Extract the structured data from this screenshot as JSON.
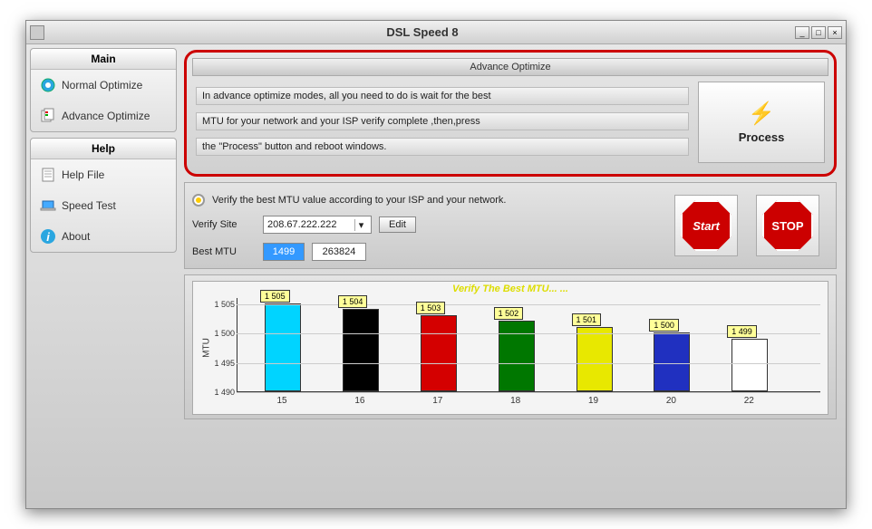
{
  "titlebar": {
    "title": "DSL Speed 8"
  },
  "sidebar": {
    "main_header": "Main",
    "help_header": "Help",
    "items": {
      "normal": "Normal Optimize",
      "advance": "Advance Optimize",
      "helpfile": "Help File",
      "speedtest": "Speed Test",
      "about": "About"
    }
  },
  "advance": {
    "header": "Advance Optimize",
    "line1": "In advance optimize modes, all you need to do is wait for the best",
    "line2": "MTU for your network and your ISP verify complete ,then,press",
    "line3": "the \"Process\" button and reboot windows.",
    "process_label": "Process"
  },
  "verify": {
    "radio_label": "Verify the best MTU value according to your ISP and your network.",
    "site_label": "Verify Site",
    "site_value": "208.67.222.222",
    "edit_label": "Edit",
    "bestmtu_label": "Best MTU",
    "bestmtu_value": "1499",
    "bestmtu_bytes": "263824",
    "start_label": "Start",
    "stop_label": "STOP"
  },
  "chart_title": "Verify The Best MTU... ...",
  "chart_data": {
    "type": "bar",
    "title": "Verify The Best MTU... ...",
    "ylabel": "MTU",
    "xlabel": "",
    "categories": [
      "15",
      "16",
      "17",
      "18",
      "19",
      "20",
      "22"
    ],
    "values": [
      1505,
      1504,
      1503,
      1502,
      1501,
      1500,
      1499
    ],
    "colors": [
      "#00d4ff",
      "#000000",
      "#d40000",
      "#007700",
      "#e8e800",
      "#2030c0",
      "#ffffff"
    ],
    "ylim": [
      1490,
      1506
    ],
    "yticks": [
      1490,
      1495,
      1500,
      1505
    ],
    "data_labels": [
      "1 505",
      "1 504",
      "1 503",
      "1 502",
      "1 501",
      "1 500",
      "1 499"
    ]
  }
}
